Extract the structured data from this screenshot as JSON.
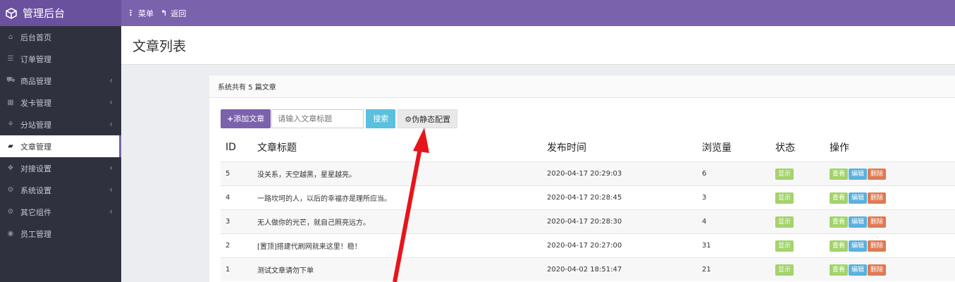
{
  "app": {
    "title": "管理后台"
  },
  "topnav": {
    "menu_label": "菜单",
    "menu_icon": "⋮",
    "back_label": "返回",
    "back_icon": "↰"
  },
  "sidebar": {
    "items": [
      {
        "label": "后台首页",
        "icon": "home-icon",
        "glyph": "⌂",
        "chevron": ""
      },
      {
        "label": "订单管理",
        "icon": "list-icon",
        "glyph": "☰",
        "chevron": ""
      },
      {
        "label": "商品管理",
        "icon": "cart-icon",
        "glyph": "⛟",
        "chevron": "‹"
      },
      {
        "label": "发卡管理",
        "icon": "grid-icon",
        "glyph": "▦",
        "chevron": "‹"
      },
      {
        "label": "分站管理",
        "icon": "sitemap-icon",
        "glyph": "⚘",
        "chevron": "‹"
      },
      {
        "label": "文章管理",
        "icon": "book-icon",
        "glyph": "▰",
        "chevron": ""
      },
      {
        "label": "对接设置",
        "icon": "cubes-icon",
        "glyph": "❖",
        "chevron": "‹"
      },
      {
        "label": "系统设置",
        "icon": "gear-icon",
        "glyph": "⚙",
        "chevron": "‹"
      },
      {
        "label": "其它组件",
        "icon": "cogs-icon",
        "glyph": "⚙",
        "chevron": "‹"
      },
      {
        "label": "员工管理",
        "icon": "user-circle-icon",
        "glyph": "◉",
        "chevron": ""
      }
    ],
    "active_index": 5
  },
  "page": {
    "title": "文章列表"
  },
  "card": {
    "heading": "系统共有 5 篇文章"
  },
  "toolbar": {
    "add_label": "添加文章",
    "search_placeholder": "请输入文章标题",
    "search_label": "搜索",
    "config_label": "伪静态配置"
  },
  "table": {
    "headers": [
      "ID",
      "文章标题",
      "发布时间",
      "浏览量",
      "状态",
      "操作"
    ],
    "rows": [
      {
        "id": "5",
        "title": "没关系，天空越黑，星星越亮。",
        "time": "2020-04-17 20:29:03",
        "views": "6",
        "status": "显示"
      },
      {
        "id": "4",
        "title": "一路坎坷的人，以后的幸福亦是理所应当。",
        "time": "2020-04-17 20:28:45",
        "views": "3",
        "status": "显示"
      },
      {
        "id": "3",
        "title": "无人做你的光芒，就自己照亮远方。",
        "time": "2020-04-17 20:28:30",
        "views": "4",
        "status": "显示"
      },
      {
        "id": "2",
        "title": "[置顶]搭建代刷网就来这里！稳！",
        "time": "2020-04-17 20:27:00",
        "views": "31",
        "status": "显示"
      },
      {
        "id": "1",
        "title": "测试文章请勿下单",
        "time": "2020-04-02 18:51:47",
        "views": "21",
        "status": "显示"
      }
    ],
    "actions": {
      "view": "查看",
      "edit": "编辑",
      "delete": "删除"
    }
  },
  "colors": {
    "primary": "#7b62ad",
    "sidebar": "#2f323e",
    "arrow": "#e8141c"
  }
}
